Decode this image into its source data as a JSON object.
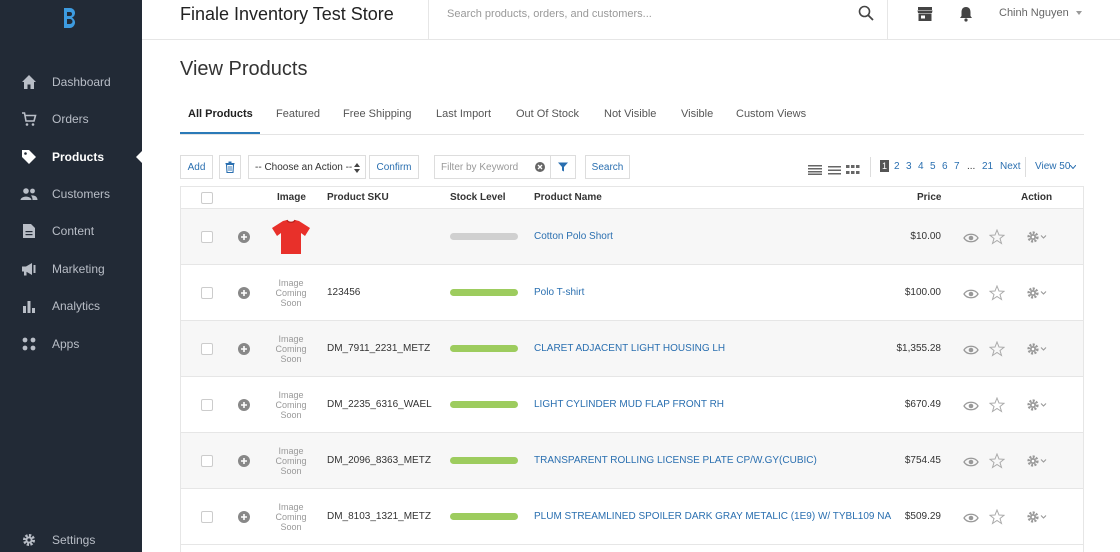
{
  "header": {
    "store_title": "Finale Inventory Test Store",
    "search_placeholder": "Search products, orders, and customers...",
    "user_name": "Chinh Nguyen"
  },
  "sidebar": {
    "items": [
      {
        "label": "Dashboard",
        "icon": "home-icon"
      },
      {
        "label": "Orders",
        "icon": "cart-icon"
      },
      {
        "label": "Products",
        "icon": "tag-icon",
        "active": true
      },
      {
        "label": "Customers",
        "icon": "people-icon"
      },
      {
        "label": "Content",
        "icon": "document-icon"
      },
      {
        "label": "Marketing",
        "icon": "megaphone-icon"
      },
      {
        "label": "Analytics",
        "icon": "bar-chart-icon"
      },
      {
        "label": "Apps",
        "icon": "grid-dots-icon"
      }
    ],
    "settings_label": "Settings"
  },
  "page": {
    "title": "View Products"
  },
  "tabs": [
    "All Products",
    "Featured",
    "Free Shipping",
    "Last Import",
    "Out Of Stock",
    "Not Visible",
    "Visible",
    "Custom Views"
  ],
  "toolbar": {
    "add_label": "Add",
    "action_select": "-- Choose an Action --",
    "confirm_label": "Confirm",
    "filter_placeholder": "Filter by Keyword",
    "search_label": "Search",
    "pages": [
      "1",
      "2",
      "3",
      "4",
      "5",
      "6",
      "7",
      "...",
      "21"
    ],
    "next_label": "Next",
    "view_label": "View 50"
  },
  "table": {
    "columns": {
      "image": "Image",
      "sku": "Product SKU",
      "stock": "Stock Level",
      "name": "Product Name",
      "price": "Price",
      "action": "Action"
    },
    "image_placeholder": [
      "Image",
      "Coming",
      "Soon"
    ],
    "rows": [
      {
        "sku": "",
        "name": "Cotton Polo Short",
        "price": "$10.00",
        "stock": "none",
        "image": "red-shirt"
      },
      {
        "sku": "123456",
        "name": "Polo T-shirt",
        "price": "$100.00",
        "stock": "in-stock",
        "image": "placeholder"
      },
      {
        "sku": "DM_7911_2231_METZ",
        "name": "CLARET ADJACENT LIGHT HOUSING LH",
        "price": "$1,355.28",
        "stock": "in-stock",
        "image": "placeholder"
      },
      {
        "sku": "DM_2235_6316_WAEL",
        "name": "LIGHT CYLINDER MUD FLAP FRONT RH",
        "price": "$670.49",
        "stock": "in-stock",
        "image": "placeholder"
      },
      {
        "sku": "DM_2096_8363_METZ",
        "name": "TRANSPARENT ROLLING LICENSE PLATE CP/W.GY(CUBIC)",
        "price": "$754.45",
        "stock": "in-stock",
        "image": "placeholder"
      },
      {
        "sku": "DM_8103_1321_METZ",
        "name": "PLUM STREAMLINED SPOILER DARK GRAY METALIC (1E9) W/ TYBL109 NA",
        "price": "$509.29",
        "stock": "in-stock",
        "image": "placeholder"
      }
    ]
  },
  "colors": {
    "sidebar_bg": "#222a36",
    "accent": "#2a6fb0",
    "stock_ok": "#9dcc5e",
    "stock_none": "#d0d0d0"
  }
}
